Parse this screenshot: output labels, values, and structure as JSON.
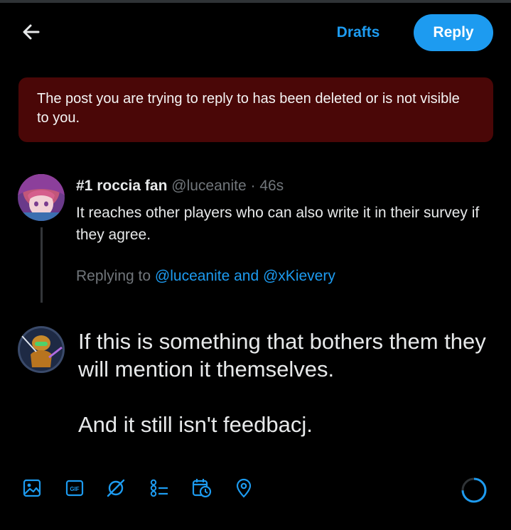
{
  "colors": {
    "accent": "#1d9bf0",
    "alert_bg": "#4a0707",
    "muted": "#71767b",
    "text": "#e7e9ea",
    "background": "#000000"
  },
  "header": {
    "back_icon": "arrow-left-icon",
    "drafts_label": "Drafts",
    "reply_label": "Reply"
  },
  "alert": {
    "message": "The post you are trying to reply to has been deleted or is not visible to you."
  },
  "parent_post": {
    "display_name": "#1 roccia fan",
    "handle": "@luceanite",
    "separator": "·",
    "time": "46s",
    "text": "It reaches other players who can also write it in their survey if they agree.",
    "replying_prefix": "Replying to",
    "replying_mentions": "@luceanite and @xKievery"
  },
  "compose": {
    "line1": "If this is something that bothers them they will mention it themselves.",
    "line2": "And it still isn't feedbacj."
  },
  "toolbar": {
    "icons": [
      "image-icon",
      "gif-icon",
      "ai-slash-icon",
      "poll-icon",
      "schedule-icon",
      "location-icon"
    ],
    "gif_text": "GIF"
  }
}
